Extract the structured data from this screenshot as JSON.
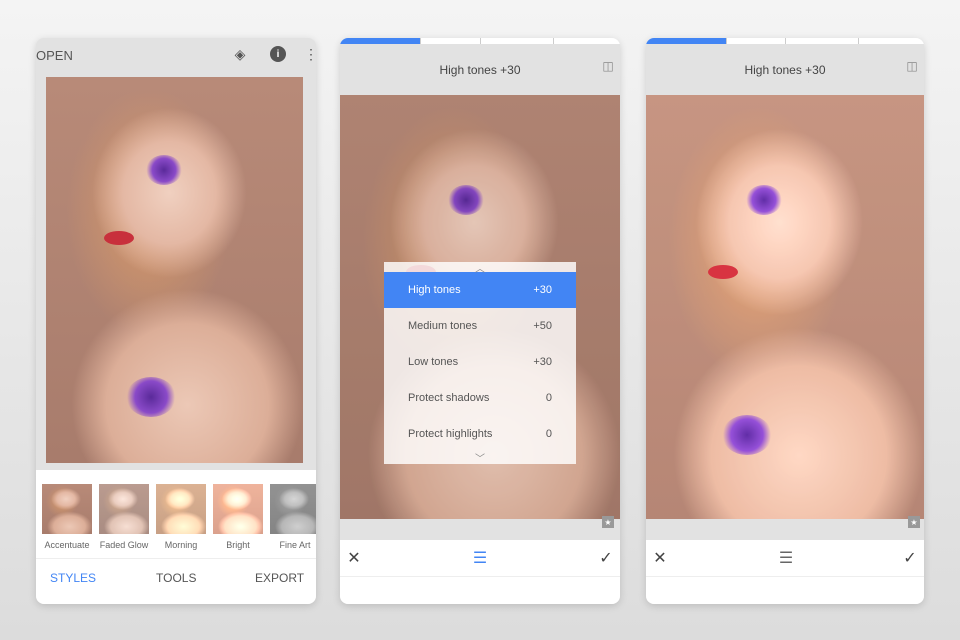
{
  "screen1": {
    "open_label": "OPEN",
    "icons": [
      "undo-layers-icon",
      "info-icon",
      "more-vert-icon"
    ],
    "styles": [
      {
        "label": "Accentuate"
      },
      {
        "label": "Faded Glow"
      },
      {
        "label": "Morning"
      },
      {
        "label": "Bright"
      },
      {
        "label": "Fine Art"
      }
    ],
    "tabs": [
      {
        "label": "STYLES"
      },
      {
        "label": "TOOLS"
      },
      {
        "label": "EXPORT"
      }
    ]
  },
  "screen2": {
    "title": "High tones +30",
    "menu": [
      {
        "label": "High tones",
        "value": "+30"
      },
      {
        "label": "Medium tones",
        "value": "+50"
      },
      {
        "label": "Low tones",
        "value": "+30"
      },
      {
        "label": "Protect shadows",
        "value": "0"
      },
      {
        "label": "Protect highlights",
        "value": "0"
      }
    ]
  },
  "screen3": {
    "title": "High tones +30"
  },
  "colors": {
    "accent": "#4285f4"
  }
}
